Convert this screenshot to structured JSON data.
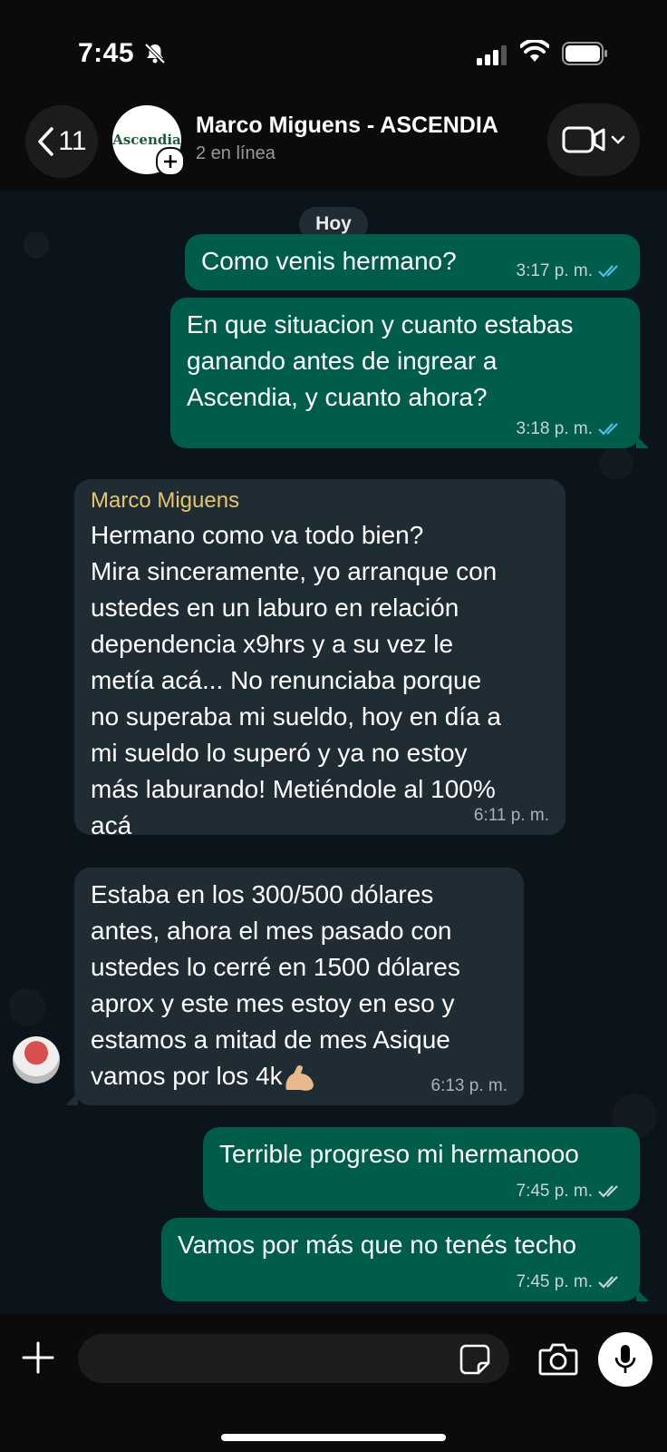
{
  "status_bar": {
    "time": "7:45"
  },
  "header": {
    "back_count": "11",
    "logo_text": "Ascendia",
    "title": "Marco Miguens - ASCENDIA",
    "subtitle": "2 en línea"
  },
  "chat": {
    "day_label": "Hoy",
    "messages": [
      {
        "direction": "out",
        "text": "Como venis hermano?",
        "time": "3:17 p. m.",
        "status": "read"
      },
      {
        "direction": "out",
        "text": "En que situacion y cuanto estabas\nganando antes de ingrear a\nAscendia, y cuanto ahora?",
        "time": "3:18 p. m.",
        "status": "read"
      },
      {
        "direction": "in",
        "sender": "Marco Miguens",
        "text": "Hermano como va todo bien?\nMira sinceramente, yo arranque con\nustedes en un laburo en relación\ndependencia x9hrs y a su vez le\nmetía acá... No renunciaba porque\nno superaba mi sueldo, hoy en día a\nmi sueldo lo superó y ya no estoy\nmás laburando! Metiéndole al 100%\nacá",
        "time": "6:11 p. m."
      },
      {
        "direction": "in",
        "text": "Estaba en los 300/500 dólares\nantes, ahora el mes pasado con\nustedes lo cerré en 1500 dólares\naprox y este mes estoy en eso y\nestamos a mitad de mes Asique\nvamos por los 4k",
        "time": "6:13 p. m."
      },
      {
        "direction": "out",
        "text": "Terrible progreso mi hermanooo",
        "time": "7:45 p. m.",
        "status": "delivered"
      },
      {
        "direction": "out",
        "text": "Vamos por más que no tenés techo",
        "time": "7:45 p. m.",
        "status": "delivered"
      }
    ]
  },
  "colors": {
    "outgoing_bubble": "#005c4b",
    "incoming_bubble": "#1f2c33",
    "read_ticks": "#53bdeb",
    "sender_name": "#e9c46a"
  }
}
